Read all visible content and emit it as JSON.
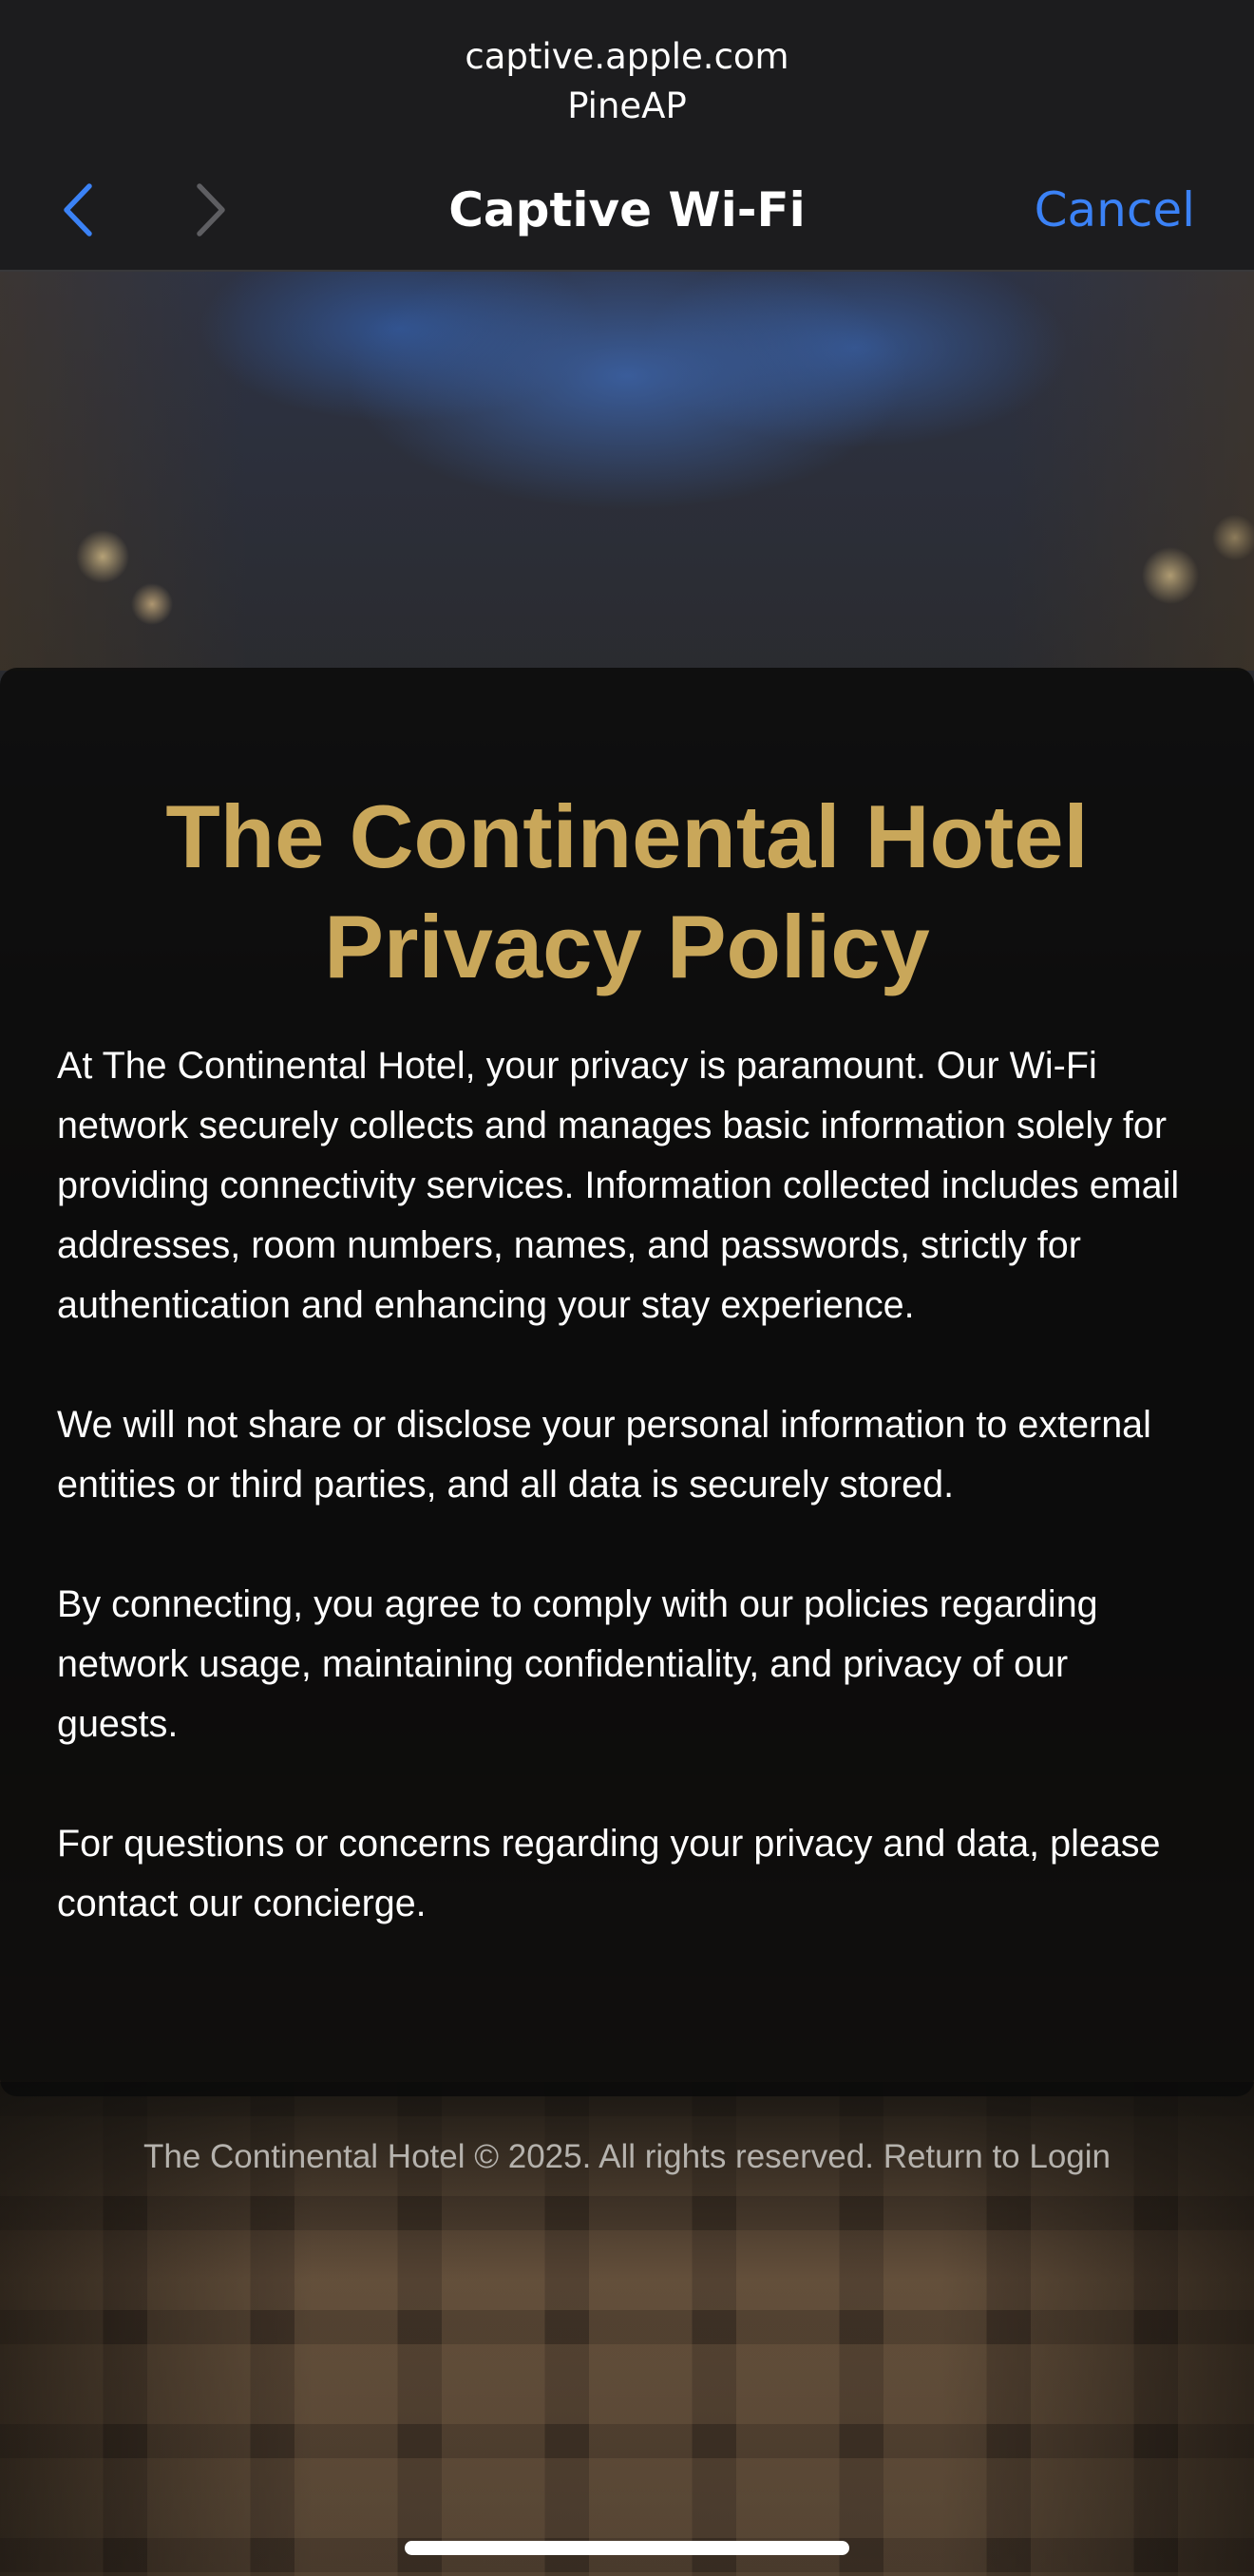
{
  "header": {
    "url": "captive.apple.com",
    "network_name": "PineAP",
    "title": "Captive Wi-Fi",
    "cancel_label": "Cancel",
    "back_icon": "chevron-left-icon",
    "forward_icon": "chevron-right-icon",
    "accent_color": "#3b82f6"
  },
  "policy": {
    "title": "The Continental Hotel Privacy Policy",
    "title_color": "#c9a75a",
    "paragraphs": [
      "At The Continental Hotel, your privacy is paramount. Our Wi-Fi network securely collects and manages basic information solely for providing connectivity services. Information collected includes email addresses, room numbers, names, and passwords, strictly for authentication and enhancing your stay experience.",
      "We will not share or disclose your personal information to external entities or third parties, and all data is securely stored.",
      "By connecting, you agree to comply with our policies regarding network usage, maintaining confidentiality, and privacy of our guests.",
      "For questions or concerns regarding your privacy and data, please contact our concierge."
    ]
  },
  "footer": {
    "copyright": "The Continental Hotel © 2025. All rights reserved.",
    "return_link": "Return to Login"
  }
}
